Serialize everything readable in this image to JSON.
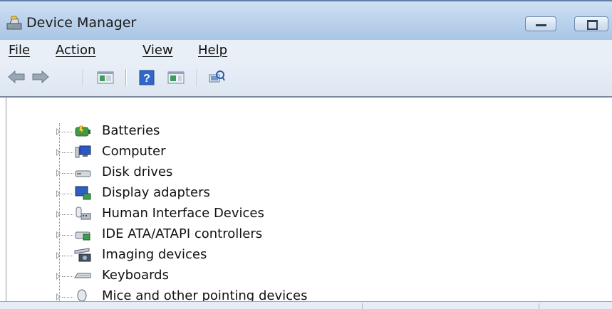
{
  "window": {
    "title": "Device Manager"
  },
  "menu": {
    "items": [
      "File",
      "Action",
      "View",
      "Help"
    ]
  },
  "toolbar": {
    "buttons": [
      {
        "icon": "back-arrow-icon"
      },
      {
        "icon": "forward-arrow-icon"
      },
      {
        "icon": "show-hide-console-tree-icon"
      },
      {
        "icon": "help-icon"
      },
      {
        "icon": "show-hide-action-pane-icon"
      },
      {
        "icon": "scan-hardware-changes-icon"
      }
    ]
  },
  "tree": {
    "items": [
      {
        "label": "Batteries",
        "icon": "battery-icon"
      },
      {
        "label": "Computer",
        "icon": "computer-icon"
      },
      {
        "label": "Disk drives",
        "icon": "disk-drive-icon"
      },
      {
        "label": "Display adapters",
        "icon": "display-adapter-icon"
      },
      {
        "label": "Human Interface Devices",
        "icon": "hid-icon"
      },
      {
        "label": "IDE ATA/ATAPI controllers",
        "icon": "ide-controller-icon"
      },
      {
        "label": "Imaging devices",
        "icon": "camera-icon"
      },
      {
        "label": "Keyboards",
        "icon": "keyboard-icon"
      },
      {
        "label": "Mice and other pointing devices",
        "icon": "mouse-icon"
      }
    ]
  },
  "colors": {
    "titlebar": "#bcd3ec",
    "menubar": "#e9eff7",
    "tree_background": "#ffffff"
  }
}
